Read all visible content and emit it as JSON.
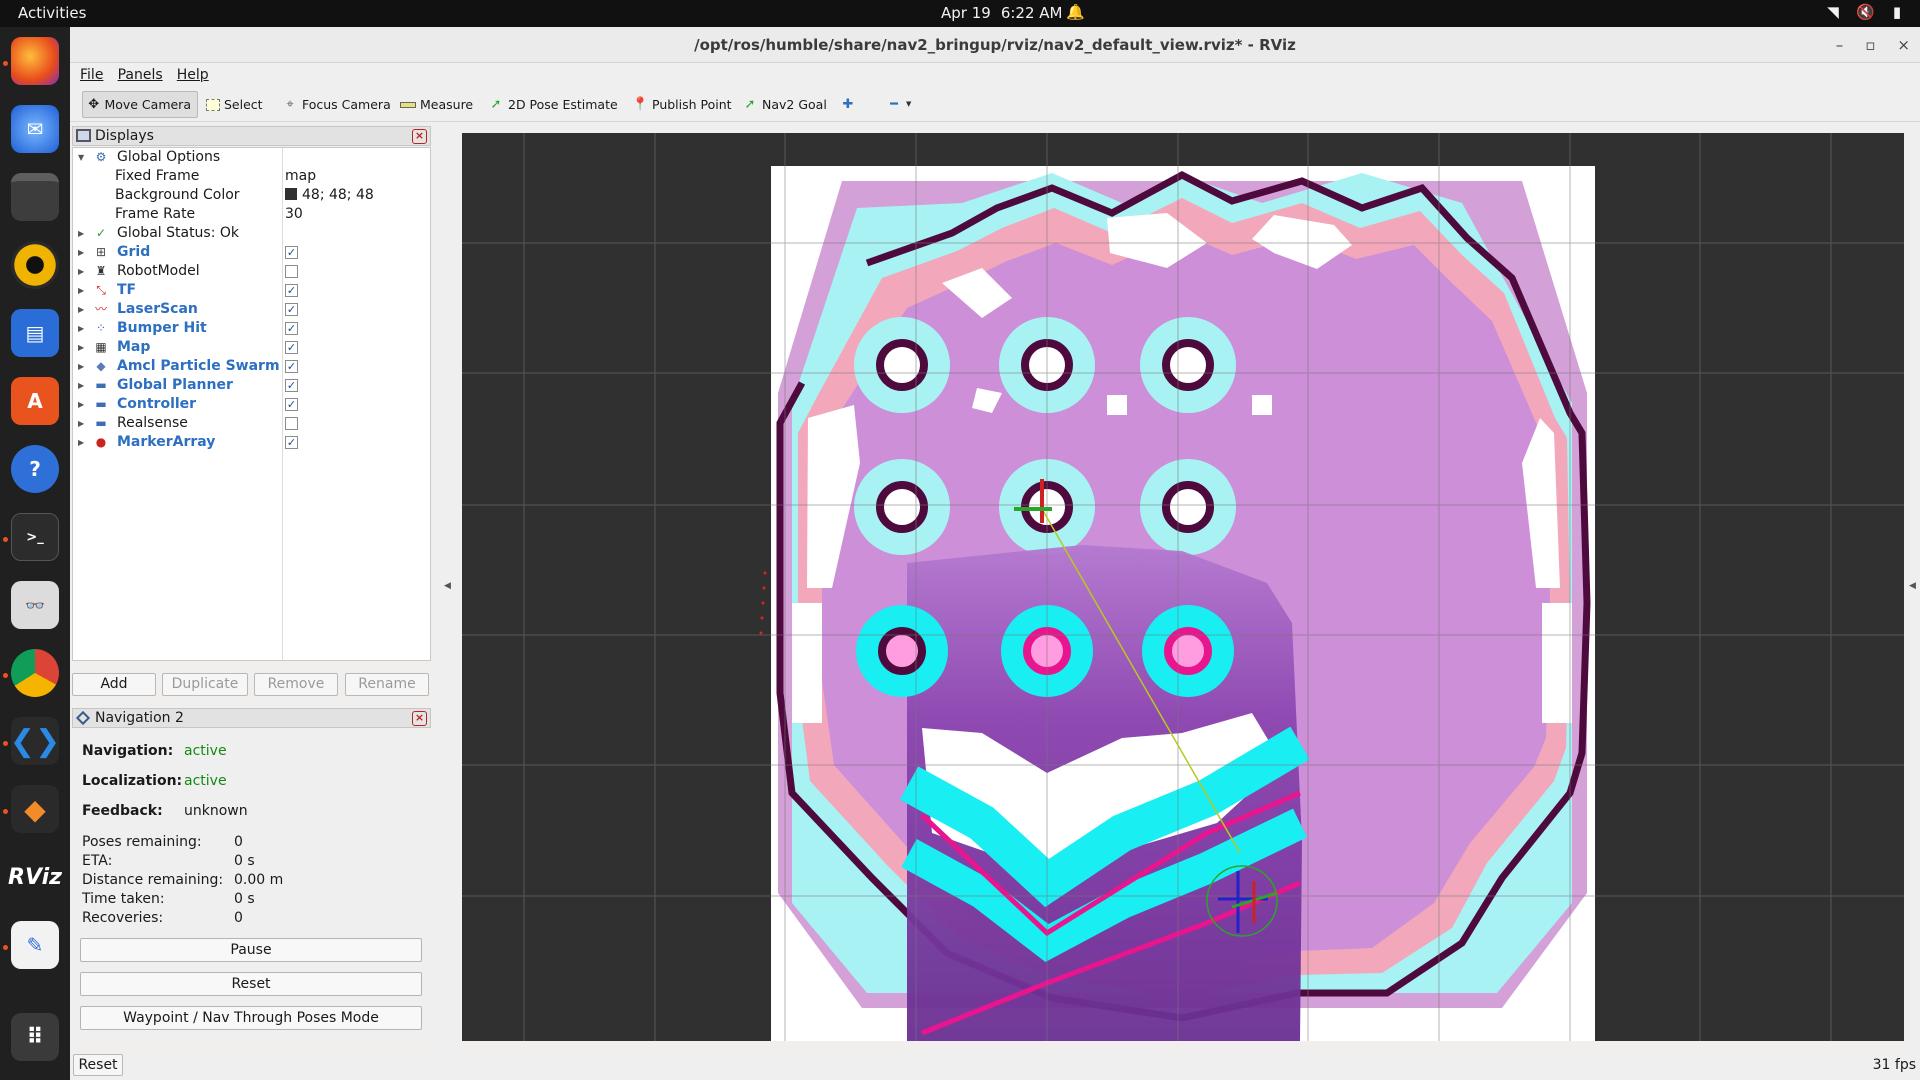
{
  "topbar": {
    "activities": "Activities",
    "date": "Apr 19",
    "time": "6:22 AM"
  },
  "window": {
    "title": "/opt/ros/humble/share/nav2_bringup/rviz/nav2_default_view.rviz* - RViz",
    "controls": [
      "–",
      "▫",
      "×"
    ]
  },
  "menubar": {
    "file": "File",
    "panels": "Panels",
    "help": "Help"
  },
  "toolbar": {
    "move_camera": "Move Camera",
    "select": "Select",
    "focus_camera": "Focus Camera",
    "measure": "Measure",
    "pose_estimate": "2D Pose Estimate",
    "publish_point": "Publish Point",
    "nav2_goal": "Nav2 Goal"
  },
  "displays": {
    "title": "Displays",
    "global_options": {
      "label": "Global Options",
      "fixed_frame_label": "Fixed Frame",
      "fixed_frame_value": "map",
      "bg_color_label": "Background Color",
      "bg_color_value": "48; 48; 48",
      "bg_color_hex": "#303030",
      "frame_rate_label": "Frame Rate",
      "frame_rate_value": "30"
    },
    "global_status": "Global Status: Ok",
    "items": [
      {
        "label": "Grid",
        "checked": true,
        "icon": "grid-icon"
      },
      {
        "label": "RobotModel",
        "checked": false,
        "icon": "robot-icon"
      },
      {
        "label": "TF",
        "checked": true,
        "icon": "tf-icon"
      },
      {
        "label": "LaserScan",
        "checked": true,
        "icon": "laser-icon"
      },
      {
        "label": "Bumper Hit",
        "checked": true,
        "icon": "points-icon"
      },
      {
        "label": "Map",
        "checked": true,
        "icon": "map-icon"
      },
      {
        "label": "Amcl Particle Swarm",
        "checked": true,
        "icon": "particle-icon"
      },
      {
        "label": "Global Planner",
        "checked": true,
        "icon": "folder-icon"
      },
      {
        "label": "Controller",
        "checked": true,
        "icon": "folder-icon"
      },
      {
        "label": "Realsense",
        "checked": false,
        "icon": "folder-icon"
      },
      {
        "label": "MarkerArray",
        "checked": true,
        "icon": "marker-icon"
      }
    ],
    "buttons": {
      "add": "Add",
      "duplicate": "Duplicate",
      "remove": "Remove",
      "rename": "Rename"
    }
  },
  "navigation": {
    "title": "Navigation 2",
    "navigation_label": "Navigation:",
    "navigation_value": "active",
    "localization_label": "Localization:",
    "localization_value": "active",
    "feedback_label": "Feedback:",
    "feedback_value": "unknown",
    "poses_label": "Poses remaining:",
    "poses_value": "0",
    "eta_label": "ETA:",
    "eta_value": "0 s",
    "distance_label": "Distance remaining:",
    "distance_value": "0.00 m",
    "time_label": "Time taken:",
    "time_value": "0 s",
    "recoveries_label": "Recoveries:",
    "recoveries_value": "0",
    "pause": "Pause",
    "reset": "Reset",
    "waypoint_mode": "Waypoint / Nav Through Poses Mode"
  },
  "statusbar": {
    "reset": "Reset",
    "fps": "31 fps"
  },
  "colors": {
    "viewport_bg": "#303030",
    "free_space": "#ffffff",
    "wall": "#4e0a3c",
    "inflation_cyan": "#a8f2f4",
    "inflation_pink": "#f4a6b6",
    "inflation_purple": "#c28fd8",
    "local_costmap_cyan": "#19eef2",
    "local_costmap_magenta": "#e8158e",
    "local_costmap_purple": "#7a3fa0",
    "path": "#b8c820"
  }
}
